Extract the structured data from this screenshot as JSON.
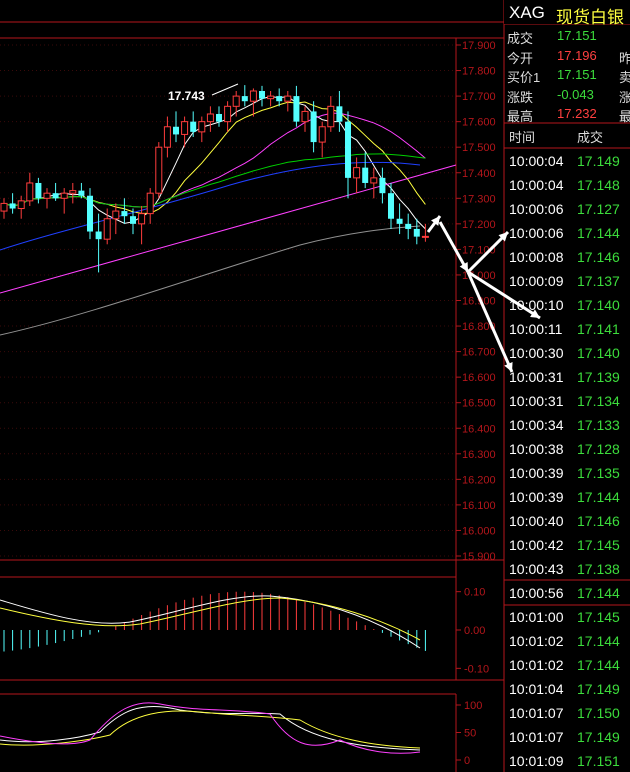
{
  "header": {
    "code": "XAG",
    "name": "现货白银"
  },
  "quote": [
    {
      "label": "成交",
      "value": "17.151",
      "color": "#3cdc3c",
      "label2": ""
    },
    {
      "label": "今开",
      "value": "17.196",
      "color": "#ff4040",
      "label2": "昨"
    },
    {
      "label": "买价1",
      "value": "17.151",
      "color": "#3cdc3c",
      "label2": "卖"
    },
    {
      "label": "涨跌",
      "value": "-0.043",
      "color": "#3cdc3c",
      "label2": "涨"
    },
    {
      "label": "最高",
      "value": "17.232",
      "color": "#ff4040",
      "label2": "最"
    }
  ],
  "tick_header": {
    "time": "时间",
    "price": "成交"
  },
  "ticks": [
    {
      "time": "10:00:04",
      "price": "17.149"
    },
    {
      "time": "10:00:04",
      "price": "17.148"
    },
    {
      "time": "10:00:06",
      "price": "17.127"
    },
    {
      "time": "10:00:06",
      "price": "17.144"
    },
    {
      "time": "10:00:08",
      "price": "17.146"
    },
    {
      "time": "10:00:09",
      "price": "17.137"
    },
    {
      "time": "10:00:10",
      "price": "17.140"
    },
    {
      "time": "10:00:11",
      "price": "17.141"
    },
    {
      "time": "10:00:30",
      "price": "17.140"
    },
    {
      "time": "10:00:31",
      "price": "17.139"
    },
    {
      "time": "10:00:31",
      "price": "17.134"
    },
    {
      "time": "10:00:34",
      "price": "17.133"
    },
    {
      "time": "10:00:38",
      "price": "17.128"
    },
    {
      "time": "10:00:39",
      "price": "17.135"
    },
    {
      "time": "10:00:39",
      "price": "17.144"
    },
    {
      "time": "10:00:40",
      "price": "17.146"
    },
    {
      "time": "10:00:42",
      "price": "17.145"
    },
    {
      "time": "10:00:43",
      "price": "17.138"
    },
    {
      "time": "10:00:56",
      "price": "17.144"
    },
    {
      "time": "10:01:00",
      "price": "17.145"
    },
    {
      "time": "10:01:02",
      "price": "17.144"
    },
    {
      "time": "10:01:02",
      "price": "17.144"
    },
    {
      "time": "10:01:04",
      "price": "17.149"
    },
    {
      "time": "10:01:07",
      "price": "17.150"
    },
    {
      "time": "10:01:07",
      "price": "17.149"
    },
    {
      "time": "10:01:09",
      "price": "17.151"
    }
  ],
  "chart_data": {
    "type": "candlestick",
    "price_ticks": [
      "17.900",
      "17.800",
      "17.700",
      "17.600",
      "17.500",
      "17.400",
      "17.300",
      "17.200",
      "17.100",
      "17.000",
      "16.900",
      "16.800",
      "16.700",
      "16.600",
      "16.500",
      "16.400",
      "16.300",
      "16.200",
      "16.100",
      "16.000",
      "15.900"
    ],
    "price_range": [
      15.9,
      17.9
    ],
    "high_label": "17.743",
    "macd_ticks": [
      "0.10",
      "0.00",
      "-0.10"
    ],
    "macd_range": [
      -0.12,
      0.12
    ],
    "kdj_ticks": [
      "100",
      "50",
      "0"
    ],
    "candles": [
      [
        17.25,
        17.3,
        17.22,
        17.28
      ],
      [
        17.28,
        17.32,
        17.24,
        17.26
      ],
      [
        17.26,
        17.31,
        17.22,
        17.29
      ],
      [
        17.29,
        17.4,
        17.27,
        17.36
      ],
      [
        17.36,
        17.38,
        17.28,
        17.3
      ],
      [
        17.3,
        17.34,
        17.26,
        17.32
      ],
      [
        17.32,
        17.36,
        17.29,
        17.3
      ],
      [
        17.3,
        17.34,
        17.24,
        17.32
      ],
      [
        17.32,
        17.36,
        17.28,
        17.33
      ],
      [
        17.33,
        17.36,
        17.3,
        17.31
      ],
      [
        17.31,
        17.34,
        17.14,
        17.17
      ],
      [
        17.17,
        17.24,
        17.01,
        17.14
      ],
      [
        17.14,
        17.26,
        17.12,
        17.22
      ],
      [
        17.22,
        17.28,
        17.16,
        17.25
      ],
      [
        17.25,
        17.3,
        17.2,
        17.23
      ],
      [
        17.23,
        17.26,
        17.16,
        17.2
      ],
      [
        17.2,
        17.27,
        17.12,
        17.24
      ],
      [
        17.24,
        17.34,
        17.2,
        17.32
      ],
      [
        17.32,
        17.52,
        17.3,
        17.5
      ],
      [
        17.5,
        17.62,
        17.46,
        17.58
      ],
      [
        17.58,
        17.64,
        17.52,
        17.55
      ],
      [
        17.55,
        17.62,
        17.5,
        17.6
      ],
      [
        17.6,
        17.64,
        17.54,
        17.56
      ],
      [
        17.56,
        17.62,
        17.52,
        17.6
      ],
      [
        17.6,
        17.66,
        17.56,
        17.63
      ],
      [
        17.63,
        17.66,
        17.58,
        17.6
      ],
      [
        17.6,
        17.68,
        17.56,
        17.66
      ],
      [
        17.66,
        17.72,
        17.62,
        17.7
      ],
      [
        17.7,
        17.743,
        17.66,
        17.68
      ],
      [
        17.68,
        17.73,
        17.62,
        17.72
      ],
      [
        17.72,
        17.74,
        17.66,
        17.69
      ],
      [
        17.69,
        17.72,
        17.66,
        17.7
      ],
      [
        17.7,
        17.73,
        17.66,
        17.68
      ],
      [
        17.68,
        17.72,
        17.64,
        17.7
      ],
      [
        17.7,
        17.74,
        17.58,
        17.6
      ],
      [
        17.6,
        17.66,
        17.56,
        17.64
      ],
      [
        17.64,
        17.68,
        17.48,
        17.52
      ],
      [
        17.52,
        17.6,
        17.46,
        17.58
      ],
      [
        17.58,
        17.7,
        17.56,
        17.66
      ],
      [
        17.66,
        17.72,
        17.56,
        17.6
      ],
      [
        17.6,
        17.64,
        17.3,
        17.38
      ],
      [
        17.38,
        17.46,
        17.32,
        17.42
      ],
      [
        17.42,
        17.48,
        17.34,
        17.36
      ],
      [
        17.36,
        17.42,
        17.3,
        17.38
      ],
      [
        17.38,
        17.42,
        17.28,
        17.32
      ],
      [
        17.32,
        17.36,
        17.18,
        17.22
      ],
      [
        17.22,
        17.28,
        17.16,
        17.2
      ],
      [
        17.2,
        17.24,
        17.14,
        17.18
      ],
      [
        17.18,
        17.22,
        17.12,
        17.15
      ],
      [
        17.15,
        17.2,
        17.13,
        17.151
      ]
    ]
  }
}
